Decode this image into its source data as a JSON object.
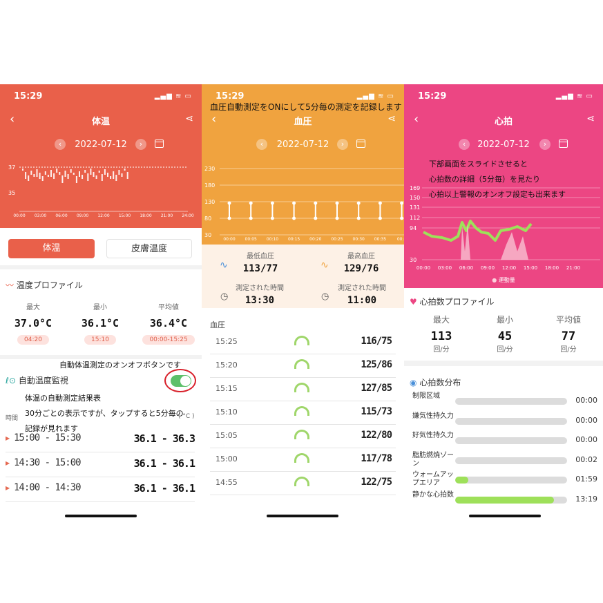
{
  "colors": {
    "temp": "#e9604a",
    "bp": "#f0a33f",
    "hr": "#ec4683"
  },
  "panel1": {
    "time": "15:29",
    "title": "体温",
    "date": "2022-07-12",
    "chart": {
      "y_labels": [
        "37",
        "35"
      ],
      "x_labels": [
        "00:00",
        "03:00",
        "06:00",
        "09:00",
        "12:00",
        "15:00",
        "18:00",
        "21:00",
        "24:00"
      ]
    },
    "tabs": [
      "体温",
      "皮膚温度"
    ],
    "profile_title": "温度プロファイル",
    "stats": [
      {
        "label": "最大",
        "value": "37.0°C",
        "time": "04:20"
      },
      {
        "label": "最小",
        "value": "36.1°C",
        "time": "15:10"
      },
      {
        "label": "平均値",
        "value": "36.4°C",
        "time": "00:00-15:25"
      }
    ],
    "annot_toggle": "自動体温測定のオンオフボタンです",
    "monitor_label": "自動温度監視",
    "annot_result": "体温の自動測定結果表",
    "annot_30a": "30分ごとの表示ですが、タップすると5分毎の",
    "annot_30b": "記録が見れます",
    "col_time": "時間",
    "col_unit": "( °C )",
    "rows": [
      {
        "t": "15:00 - 15:30",
        "v": "36.1 - 36.3"
      },
      {
        "t": "14:30 - 15:00",
        "v": "36.1 - 36.1"
      },
      {
        "t": "14:00 - 14:30",
        "v": "36.1 - 36.1"
      }
    ]
  },
  "panel2": {
    "time": "15:29",
    "title": "血圧",
    "date": "2022-07-12",
    "annot": "血圧自動測定をONにして5分毎の測定を記録します",
    "chart": {
      "y_labels": [
        "230",
        "180",
        "130",
        "80",
        "30"
      ],
      "x_labels": [
        "00:00",
        "00:05",
        "00:10",
        "00:15",
        "00:20",
        "00:25",
        "00:30",
        "00:35",
        "00:4"
      ]
    },
    "min_label": "最低血圧",
    "min_value": "113/77",
    "max_label": "最高血圧",
    "max_value": "129/76",
    "min_time_label": "測定された時間",
    "min_time": "13:30",
    "max_time_label": "測定された時間",
    "max_time": "11:00",
    "list_title": "血圧",
    "rows": [
      {
        "t": "15:25",
        "v": "116/75"
      },
      {
        "t": "15:20",
        "v": "125/86"
      },
      {
        "t": "15:15",
        "v": "127/85"
      },
      {
        "t": "15:10",
        "v": "115/73"
      },
      {
        "t": "15:05",
        "v": "122/80"
      },
      {
        "t": "15:00",
        "v": "117/78"
      },
      {
        "t": "14:55",
        "v": "122/75"
      }
    ]
  },
  "panel3": {
    "time": "15:29",
    "title": "心拍",
    "date": "2022-07-12",
    "annot1": "下部画面をスライドさせると",
    "annot2": "心拍数の詳細（5分毎）を見たり",
    "annot3": "心拍以上警報のオンオフ設定も出来ます",
    "chart": {
      "y_labels": [
        "169",
        "150",
        "131",
        "112",
        "94",
        "30"
      ],
      "x_labels": [
        "00:00",
        "03:00",
        "06:00",
        "09:00",
        "12:00",
        "15:00",
        "18:00",
        "21:00"
      ],
      "legend": "運動量"
    },
    "profile_title": "心拍数プロファイル",
    "stats": [
      {
        "label": "最大",
        "value": "113",
        "unit": "回/分"
      },
      {
        "label": "最小",
        "value": "45",
        "unit": "回/分"
      },
      {
        "label": "平均値",
        "value": "77",
        "unit": "回/分"
      }
    ],
    "dist_title": "心拍数分布",
    "zones": [
      {
        "label": "制限区域",
        "time": "00:00",
        "fill": 0
      },
      {
        "label": "嫌気性持久力",
        "time": "00:00",
        "fill": 0
      },
      {
        "label": "好気性持久力",
        "time": "00:00",
        "fill": 0
      },
      {
        "label": "脂肪燃焼ゾーン",
        "time": "00:02",
        "fill": 0
      },
      {
        "label": "ウォームアップエリア",
        "time": "01:59",
        "fill": 0.12
      },
      {
        "label": "静かな心拍数",
        "time": "13:19",
        "fill": 0.88
      }
    ]
  }
}
